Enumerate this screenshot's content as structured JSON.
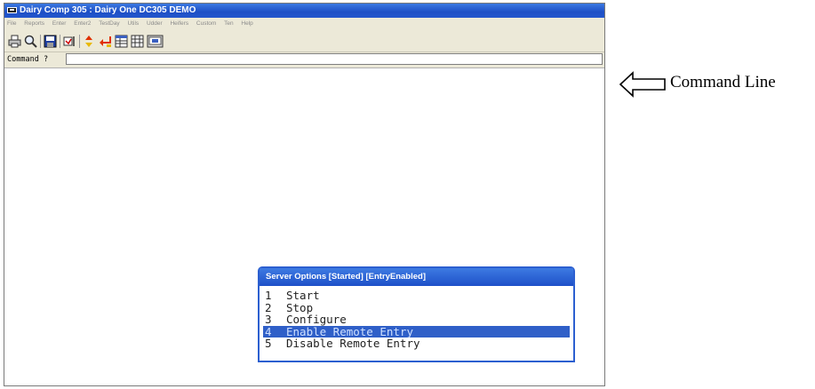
{
  "window": {
    "title": "Dairy Comp 305 : Dairy One DC305 DEMO"
  },
  "menubar": {
    "items": [
      "File",
      "Reports",
      "Enter",
      "Enter2",
      "TestDay",
      "Utils",
      "Udder",
      "Heifers",
      "Custom",
      "Ten",
      "Help"
    ]
  },
  "toolbar": {
    "buttons": [
      "print-icon",
      "preview-icon",
      "save-icon",
      "next-icon",
      "sort-icon",
      "enter-icon",
      "grid-icon",
      "table-icon",
      "screen-icon"
    ]
  },
  "command": {
    "label": "Command ?",
    "value": ""
  },
  "dialog": {
    "title": "Server Options [Started] [EntryEnabled]",
    "items": [
      {
        "num": "1",
        "label": "Start"
      },
      {
        "num": "2",
        "label": "Stop"
      },
      {
        "num": "3",
        "label": "Configure"
      },
      {
        "num": "4",
        "label": "Enable Remote Entry"
      },
      {
        "num": "5",
        "label": "Disable Remote Entry"
      }
    ],
    "selected_index": 3
  },
  "annotation": {
    "label": "Command Line"
  },
  "colors": {
    "title_bar": "#1e4fc6",
    "selection": "#2f5fc8"
  }
}
